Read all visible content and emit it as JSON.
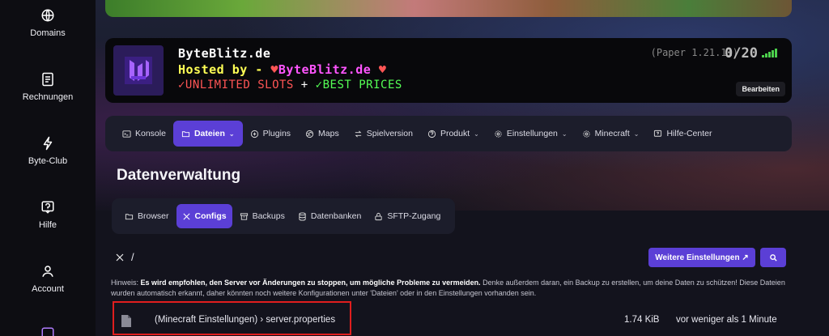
{
  "sidebar": {
    "items": [
      {
        "label": "Domains",
        "icon": "globe-icon"
      },
      {
        "label": "Rechnungen",
        "icon": "invoice-icon"
      },
      {
        "label": "Byte-Club",
        "icon": "lightning-icon"
      },
      {
        "label": "Hilfe",
        "icon": "help-icon"
      },
      {
        "label": "Account",
        "icon": "user-icon"
      }
    ]
  },
  "server": {
    "motd_line1": "ByteBlitz.de",
    "motd_line2_prefix": "Hosted by - ",
    "motd_heart": "♥",
    "motd_line2_name": "ByteBlitz.de",
    "motd_line3_a": "✓UNLIMITED SLOTS",
    "motd_line3_plus": " + ",
    "motd_line3_b": "✓BEST PRICES",
    "version": "(Paper 1.21.11)",
    "players": "0/20",
    "edit_label": "Bearbeiten"
  },
  "nav": {
    "items": [
      {
        "label": "Konsole",
        "icon": "console-icon"
      },
      {
        "label": "Dateien",
        "icon": "folder-icon"
      },
      {
        "label": "Plugins",
        "icon": "plugin-icon"
      },
      {
        "label": "Maps",
        "icon": "map-icon"
      },
      {
        "label": "Spielversion",
        "icon": "swap-icon"
      },
      {
        "label": "Produkt",
        "icon": "product-icon"
      },
      {
        "label": "Einstellungen",
        "icon": "gear-icon"
      },
      {
        "label": "Minecraft",
        "icon": "gear-icon"
      },
      {
        "label": "Hilfe-Center",
        "icon": "help-icon"
      }
    ],
    "active": "Dateien"
  },
  "page_title": "Datenverwaltung",
  "subtabs": {
    "items": [
      {
        "label": "Browser",
        "icon": "folder-icon"
      },
      {
        "label": "Configs",
        "icon": "tools-icon"
      },
      {
        "label": "Backups",
        "icon": "archive-icon"
      },
      {
        "label": "Datenbanken",
        "icon": "database-icon"
      },
      {
        "label": "SFTP-Zugang",
        "icon": "lock-icon"
      }
    ],
    "active": "Configs"
  },
  "path": {
    "separator": "/"
  },
  "buttons": {
    "more_settings": "Weitere Einstellungen ↗"
  },
  "hint": {
    "prefix": "Hinweis: ",
    "bold": "Es wird empfohlen, den Server vor Änderungen zu stoppen, um mögliche Probleme zu vermeiden.",
    "rest": " Denke außerdem daran, ein Backup zu erstellen, um deine Daten zu schützen! Diese Dateien wurden automatisch erkannt, daher könnten noch weitere Konfigurationen unter 'Dateien' oder in den Einstellungen vorhanden sein."
  },
  "files": [
    {
      "name": "(Minecraft Einstellungen) › server.properties",
      "size": "1.74 KiB",
      "modified": "vor weniger als 1 Minute"
    }
  ],
  "colors": {
    "accent": "#5b3fd6",
    "highlight": "#e01e1e"
  }
}
